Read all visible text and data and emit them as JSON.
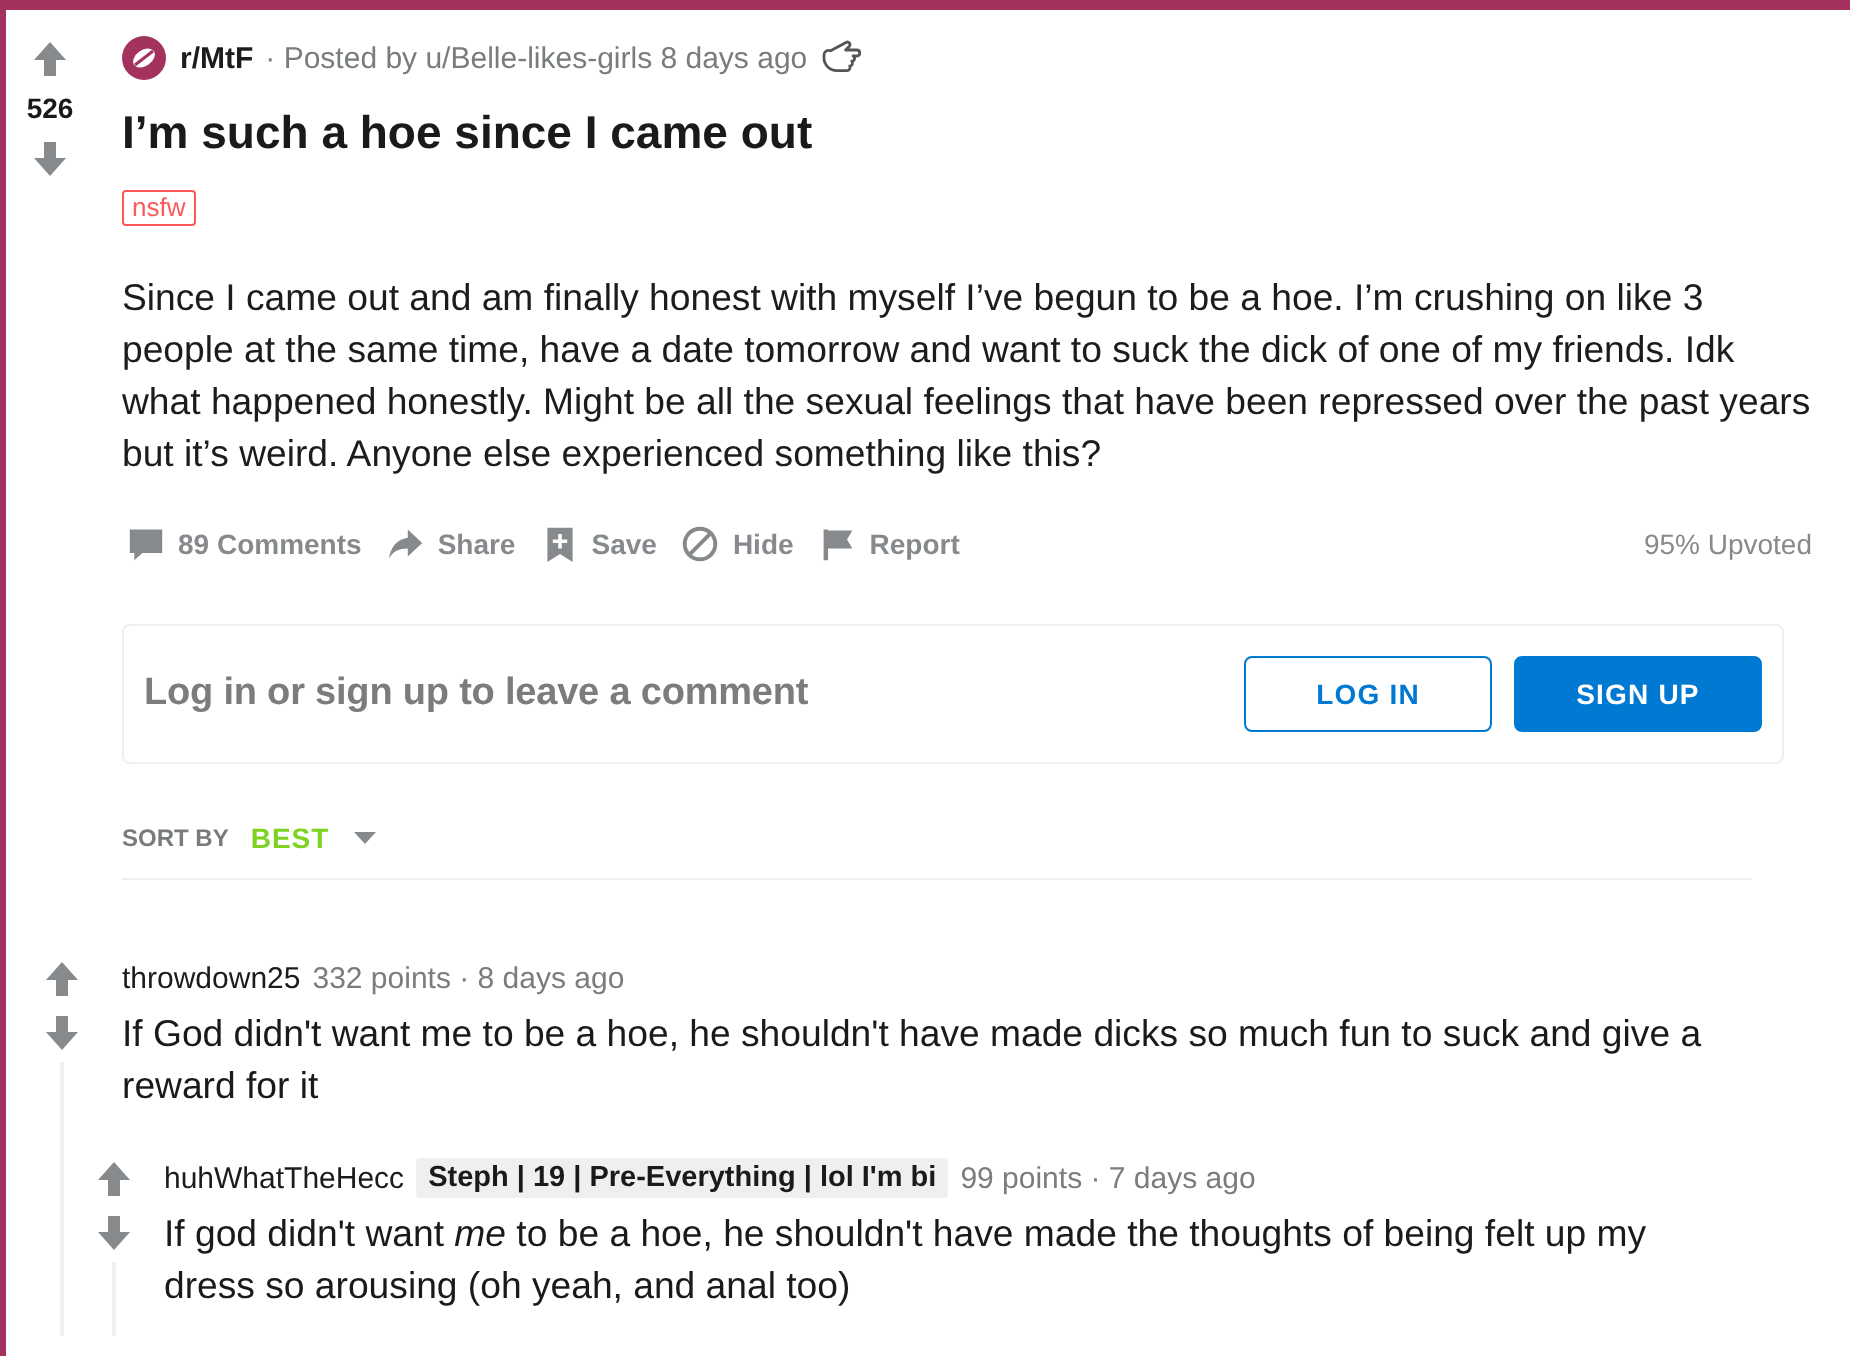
{
  "post": {
    "score": "526",
    "subreddit": "r/MtF",
    "byline": "· Posted by u/Belle-likes-girls 8 days ago",
    "title": "I’m such a hoe since I came out",
    "tag": "nsfw",
    "body": "Since I came out and am finally honest with myself I’ve begun to be a hoe. I’m crushing on like 3 people at the same time, have a date tomorrow and want to suck the dick of one of my friends. Idk what happened honestly. Might be all the sexual feelings that have been repressed over the past years but it’s weird. Anyone else experienced something like this?",
    "actions": [
      {
        "kind": "comments",
        "label": "89 Comments"
      },
      {
        "kind": "share",
        "label": "Share"
      },
      {
        "kind": "save",
        "label": "Save"
      },
      {
        "kind": "hide",
        "label": "Hide"
      },
      {
        "kind": "report",
        "label": "Report"
      }
    ],
    "upvote_ratio": "95% Upvoted"
  },
  "comment_prompt": {
    "text": "Log in or sign up to leave a comment",
    "buttons": [
      {
        "kind": "outline",
        "label": "LOG IN"
      },
      {
        "kind": "filled",
        "label": "SIGN UP"
      }
    ]
  },
  "sort": {
    "label": "SORT BY",
    "value": "BEST"
  },
  "comments": [
    {
      "author": "throwdown25",
      "meta": "332 points · 8 days ago",
      "body": "If God didn't want me to be a hoe, he shouldn't have made dicks so much fun to suck and give a reward for it",
      "children": [
        {
          "author": "huhWhatTheHecc",
          "flair": "Steph | 19 | Pre-Everything | lol I'm bi",
          "meta": "99 points · 7 days ago",
          "body": "If god didn't want *me* to be a hoe, he shouldn't have made the thoughts of being felt up my dress so arousing (oh yeah, and anal too)"
        }
      ]
    }
  ]
}
